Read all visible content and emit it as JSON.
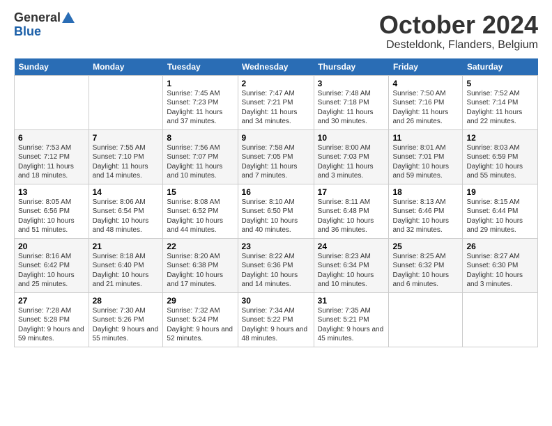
{
  "header": {
    "logo_general": "General",
    "logo_blue": "Blue",
    "month": "October 2024",
    "location": "Desteldonk, Flanders, Belgium"
  },
  "days_of_week": [
    "Sunday",
    "Monday",
    "Tuesday",
    "Wednesday",
    "Thursday",
    "Friday",
    "Saturday"
  ],
  "weeks": [
    [
      {
        "day": "",
        "sunrise": "",
        "sunset": "",
        "daylight": ""
      },
      {
        "day": "",
        "sunrise": "",
        "sunset": "",
        "daylight": ""
      },
      {
        "day": "1",
        "sunrise": "Sunrise: 7:45 AM",
        "sunset": "Sunset: 7:23 PM",
        "daylight": "Daylight: 11 hours and 37 minutes."
      },
      {
        "day": "2",
        "sunrise": "Sunrise: 7:47 AM",
        "sunset": "Sunset: 7:21 PM",
        "daylight": "Daylight: 11 hours and 34 minutes."
      },
      {
        "day": "3",
        "sunrise": "Sunrise: 7:48 AM",
        "sunset": "Sunset: 7:18 PM",
        "daylight": "Daylight: 11 hours and 30 minutes."
      },
      {
        "day": "4",
        "sunrise": "Sunrise: 7:50 AM",
        "sunset": "Sunset: 7:16 PM",
        "daylight": "Daylight: 11 hours and 26 minutes."
      },
      {
        "day": "5",
        "sunrise": "Sunrise: 7:52 AM",
        "sunset": "Sunset: 7:14 PM",
        "daylight": "Daylight: 11 hours and 22 minutes."
      }
    ],
    [
      {
        "day": "6",
        "sunrise": "Sunrise: 7:53 AM",
        "sunset": "Sunset: 7:12 PM",
        "daylight": "Daylight: 11 hours and 18 minutes."
      },
      {
        "day": "7",
        "sunrise": "Sunrise: 7:55 AM",
        "sunset": "Sunset: 7:10 PM",
        "daylight": "Daylight: 11 hours and 14 minutes."
      },
      {
        "day": "8",
        "sunrise": "Sunrise: 7:56 AM",
        "sunset": "Sunset: 7:07 PM",
        "daylight": "Daylight: 11 hours and 10 minutes."
      },
      {
        "day": "9",
        "sunrise": "Sunrise: 7:58 AM",
        "sunset": "Sunset: 7:05 PM",
        "daylight": "Daylight: 11 hours and 7 minutes."
      },
      {
        "day": "10",
        "sunrise": "Sunrise: 8:00 AM",
        "sunset": "Sunset: 7:03 PM",
        "daylight": "Daylight: 11 hours and 3 minutes."
      },
      {
        "day": "11",
        "sunrise": "Sunrise: 8:01 AM",
        "sunset": "Sunset: 7:01 PM",
        "daylight": "Daylight: 10 hours and 59 minutes."
      },
      {
        "day": "12",
        "sunrise": "Sunrise: 8:03 AM",
        "sunset": "Sunset: 6:59 PM",
        "daylight": "Daylight: 10 hours and 55 minutes."
      }
    ],
    [
      {
        "day": "13",
        "sunrise": "Sunrise: 8:05 AM",
        "sunset": "Sunset: 6:56 PM",
        "daylight": "Daylight: 10 hours and 51 minutes."
      },
      {
        "day": "14",
        "sunrise": "Sunrise: 8:06 AM",
        "sunset": "Sunset: 6:54 PM",
        "daylight": "Daylight: 10 hours and 48 minutes."
      },
      {
        "day": "15",
        "sunrise": "Sunrise: 8:08 AM",
        "sunset": "Sunset: 6:52 PM",
        "daylight": "Daylight: 10 hours and 44 minutes."
      },
      {
        "day": "16",
        "sunrise": "Sunrise: 8:10 AM",
        "sunset": "Sunset: 6:50 PM",
        "daylight": "Daylight: 10 hours and 40 minutes."
      },
      {
        "day": "17",
        "sunrise": "Sunrise: 8:11 AM",
        "sunset": "Sunset: 6:48 PM",
        "daylight": "Daylight: 10 hours and 36 minutes."
      },
      {
        "day": "18",
        "sunrise": "Sunrise: 8:13 AM",
        "sunset": "Sunset: 6:46 PM",
        "daylight": "Daylight: 10 hours and 32 minutes."
      },
      {
        "day": "19",
        "sunrise": "Sunrise: 8:15 AM",
        "sunset": "Sunset: 6:44 PM",
        "daylight": "Daylight: 10 hours and 29 minutes."
      }
    ],
    [
      {
        "day": "20",
        "sunrise": "Sunrise: 8:16 AM",
        "sunset": "Sunset: 6:42 PM",
        "daylight": "Daylight: 10 hours and 25 minutes."
      },
      {
        "day": "21",
        "sunrise": "Sunrise: 8:18 AM",
        "sunset": "Sunset: 6:40 PM",
        "daylight": "Daylight: 10 hours and 21 minutes."
      },
      {
        "day": "22",
        "sunrise": "Sunrise: 8:20 AM",
        "sunset": "Sunset: 6:38 PM",
        "daylight": "Daylight: 10 hours and 17 minutes."
      },
      {
        "day": "23",
        "sunrise": "Sunrise: 8:22 AM",
        "sunset": "Sunset: 6:36 PM",
        "daylight": "Daylight: 10 hours and 14 minutes."
      },
      {
        "day": "24",
        "sunrise": "Sunrise: 8:23 AM",
        "sunset": "Sunset: 6:34 PM",
        "daylight": "Daylight: 10 hours and 10 minutes."
      },
      {
        "day": "25",
        "sunrise": "Sunrise: 8:25 AM",
        "sunset": "Sunset: 6:32 PM",
        "daylight": "Daylight: 10 hours and 6 minutes."
      },
      {
        "day": "26",
        "sunrise": "Sunrise: 8:27 AM",
        "sunset": "Sunset: 6:30 PM",
        "daylight": "Daylight: 10 hours and 3 minutes."
      }
    ],
    [
      {
        "day": "27",
        "sunrise": "Sunrise: 7:28 AM",
        "sunset": "Sunset: 5:28 PM",
        "daylight": "Daylight: 9 hours and 59 minutes."
      },
      {
        "day": "28",
        "sunrise": "Sunrise: 7:30 AM",
        "sunset": "Sunset: 5:26 PM",
        "daylight": "Daylight: 9 hours and 55 minutes."
      },
      {
        "day": "29",
        "sunrise": "Sunrise: 7:32 AM",
        "sunset": "Sunset: 5:24 PM",
        "daylight": "Daylight: 9 hours and 52 minutes."
      },
      {
        "day": "30",
        "sunrise": "Sunrise: 7:34 AM",
        "sunset": "Sunset: 5:22 PM",
        "daylight": "Daylight: 9 hours and 48 minutes."
      },
      {
        "day": "31",
        "sunrise": "Sunrise: 7:35 AM",
        "sunset": "Sunset: 5:21 PM",
        "daylight": "Daylight: 9 hours and 45 minutes."
      },
      {
        "day": "",
        "sunrise": "",
        "sunset": "",
        "daylight": ""
      },
      {
        "day": "",
        "sunrise": "",
        "sunset": "",
        "daylight": ""
      }
    ]
  ]
}
